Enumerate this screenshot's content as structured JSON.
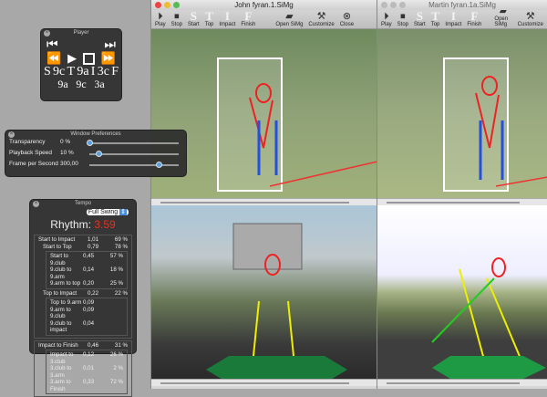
{
  "player": {
    "title": "Player",
    "markers_top": [
      "S",
      "9c",
      "T",
      "9a",
      "I",
      "3c",
      "F"
    ],
    "markers_bottom": [
      "9a",
      "9c",
      "3a"
    ]
  },
  "prefs": {
    "title": "Window Preferences",
    "rows": [
      {
        "label": "Transparency",
        "value": "0 %",
        "level": 0
      },
      {
        "label": "Playback Speed",
        "value": "10 %",
        "level": 0.1
      },
      {
        "label": "Frame per Second",
        "value": "300,00",
        "level": 0.78
      }
    ]
  },
  "tempo": {
    "title": "Tempo",
    "mode": "Full Swing",
    "rhythm_label": "Rhythm:",
    "rhythm_value": "3.59",
    "accent": "#e8321e",
    "groups": [
      {
        "label": "Start to Impact",
        "time": "1,01",
        "pct": "69 %",
        "sub": [
          {
            "label": "Start to Top",
            "time": "0,79",
            "pct": "78 %",
            "items": [
              {
                "label": "Start to 9.club",
                "time": "0,45",
                "pct": "57 %"
              },
              {
                "label": "9.club to 9.arm",
                "time": "0,14",
                "pct": "18 %"
              },
              {
                "label": "9.arm to top",
                "time": "0,20",
                "pct": "25 %"
              }
            ]
          },
          {
            "label": "Top to Impact",
            "time": "0,22",
            "pct": "22 %",
            "items": [
              {
                "label": "Top to 9.arm",
                "time": "0,09",
                "pct": ""
              },
              {
                "label": "9.arm to 9.club",
                "time": "0,09",
                "pct": ""
              },
              {
                "label": "9.club to impact",
                "time": "0,04",
                "pct": ""
              }
            ]
          }
        ]
      },
      {
        "label": "Impact to Finish",
        "time": "0,46",
        "pct": "31 %",
        "sub": [
          {
            "label": "",
            "time": "",
            "pct": "",
            "items": [
              {
                "label": "Impact to 3.club",
                "time": "0,12",
                "pct": "26 %"
              },
              {
                "label": "3.club to 3.arm",
                "time": "0,01",
                "pct": "2 %"
              },
              {
                "label": "3.arm to Finish",
                "time": "0,33",
                "pct": "72 %"
              }
            ]
          }
        ]
      }
    ]
  },
  "windows": [
    {
      "title": "John fyran.1.SiMg",
      "toolbar": [
        "Play",
        "Stop",
        "Start",
        "Top",
        "Impact",
        "Finish",
        "Open SiMg",
        "Customize",
        "Close"
      ]
    },
    {
      "title": "Martin fyran.1a.SiMg",
      "toolbar": [
        "Play",
        "Stop",
        "Start",
        "Top",
        "Impact",
        "Finish",
        "Open SiMg",
        "Customize"
      ]
    }
  ]
}
